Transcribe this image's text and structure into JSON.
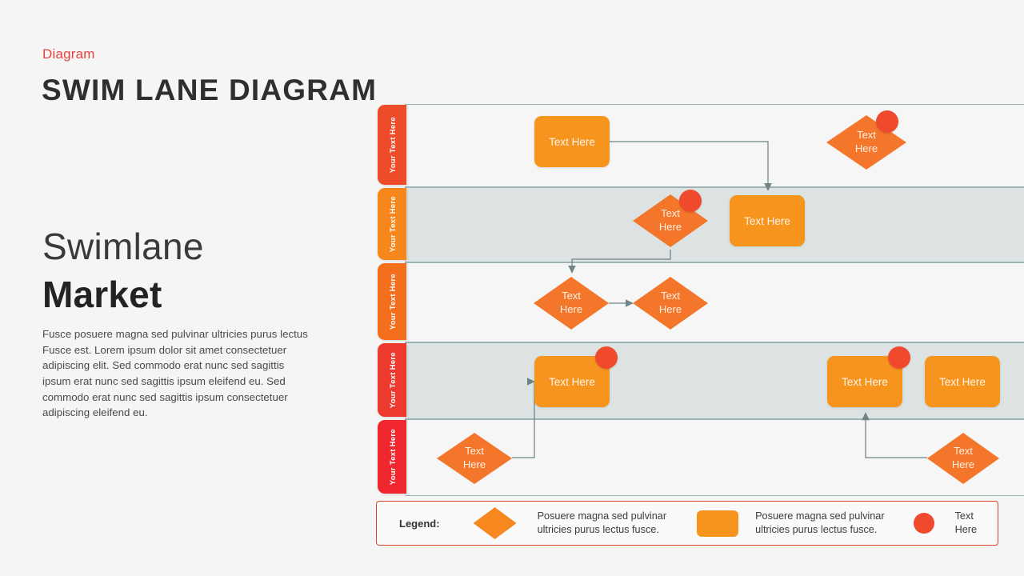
{
  "header": {
    "kicker": "Diagram",
    "title": "SWIM LANE DIAGRAM"
  },
  "intro": {
    "heading_light": "Swimlane",
    "heading_bold": "Market",
    "body": "Fusce posuere magna sed pulvinar ultricies purus lectus Fusce est. Lorem ipsum dolor sit amet consectetuer adipiscing elit. Sed commodo  erat nunc sed sagittis ipsum erat nunc sed sagittis ipsum eleifend eu. Sed commodo  erat nunc sed sagittis ipsum consectetuer adipiscing eleifend eu."
  },
  "colors": {
    "accent_red": "#E8413F",
    "node_orange": "#F7941E",
    "diamond_orange": "#F4762A",
    "badge_red": "#EF4A2E",
    "lane_shaded": "#DCE3E2",
    "lane_plain": "#F5F6F5",
    "lane_border": "#9FB3B2",
    "connector": "#6E8486",
    "legend_border": "#D9472B",
    "page_bg": "#F4F5F4"
  },
  "lanes": [
    {
      "label": "Your Text Here",
      "tab_color": "#EE4B2B",
      "shaded": false
    },
    {
      "label": "Your Text Here",
      "tab_color": "#F7871C",
      "shaded": true
    },
    {
      "label": "Your Text Here",
      "tab_color": "#F36F1E",
      "shaded": false
    },
    {
      "label": "Your Text Here",
      "tab_color": "#EC3B2E",
      "shaded": true
    },
    {
      "label": "Your Text Here",
      "tab_color": "#F0272F",
      "shaded": false
    }
  ],
  "nodes": [
    {
      "id": "n1",
      "lane": 1,
      "shape": "rect",
      "label": "Text Here",
      "badge": false
    },
    {
      "id": "n2",
      "lane": 1,
      "shape": "diamond",
      "label": "Text\nHere",
      "badge": true
    },
    {
      "id": "n3",
      "lane": 2,
      "shape": "diamond",
      "label": "Text\nHere",
      "badge": true
    },
    {
      "id": "n4",
      "lane": 2,
      "shape": "rect",
      "label": "Text Here",
      "badge": false
    },
    {
      "id": "n5",
      "lane": 3,
      "shape": "diamond",
      "label": "Text\nHere",
      "badge": false
    },
    {
      "id": "n6",
      "lane": 3,
      "shape": "diamond",
      "label": "Text\nHere",
      "badge": false
    },
    {
      "id": "n7",
      "lane": 4,
      "shape": "rect",
      "label": "Text Here",
      "badge": true
    },
    {
      "id": "n8",
      "lane": 4,
      "shape": "rect",
      "label": "Text Here",
      "badge": true
    },
    {
      "id": "n9",
      "lane": 4,
      "shape": "rect",
      "label": "Text Here",
      "badge": false
    },
    {
      "id": "n10",
      "lane": 5,
      "shape": "diamond",
      "label": "Text\nHere",
      "badge": false
    },
    {
      "id": "n11",
      "lane": 5,
      "shape": "diamond",
      "label": "Text\nHere",
      "badge": false
    }
  ],
  "legend": {
    "title": "Legend:",
    "items": [
      {
        "symbol": "diamond",
        "text_line1": "Posuere magna sed pulvinar",
        "text_line2": "ultricies purus lectus fusce."
      },
      {
        "symbol": "rect",
        "text_line1": "Posuere magna sed pulvinar",
        "text_line2": "ultricies purus lectus fusce."
      },
      {
        "symbol": "circle",
        "text_line1": "Text",
        "text_line2": "Here"
      }
    ]
  }
}
